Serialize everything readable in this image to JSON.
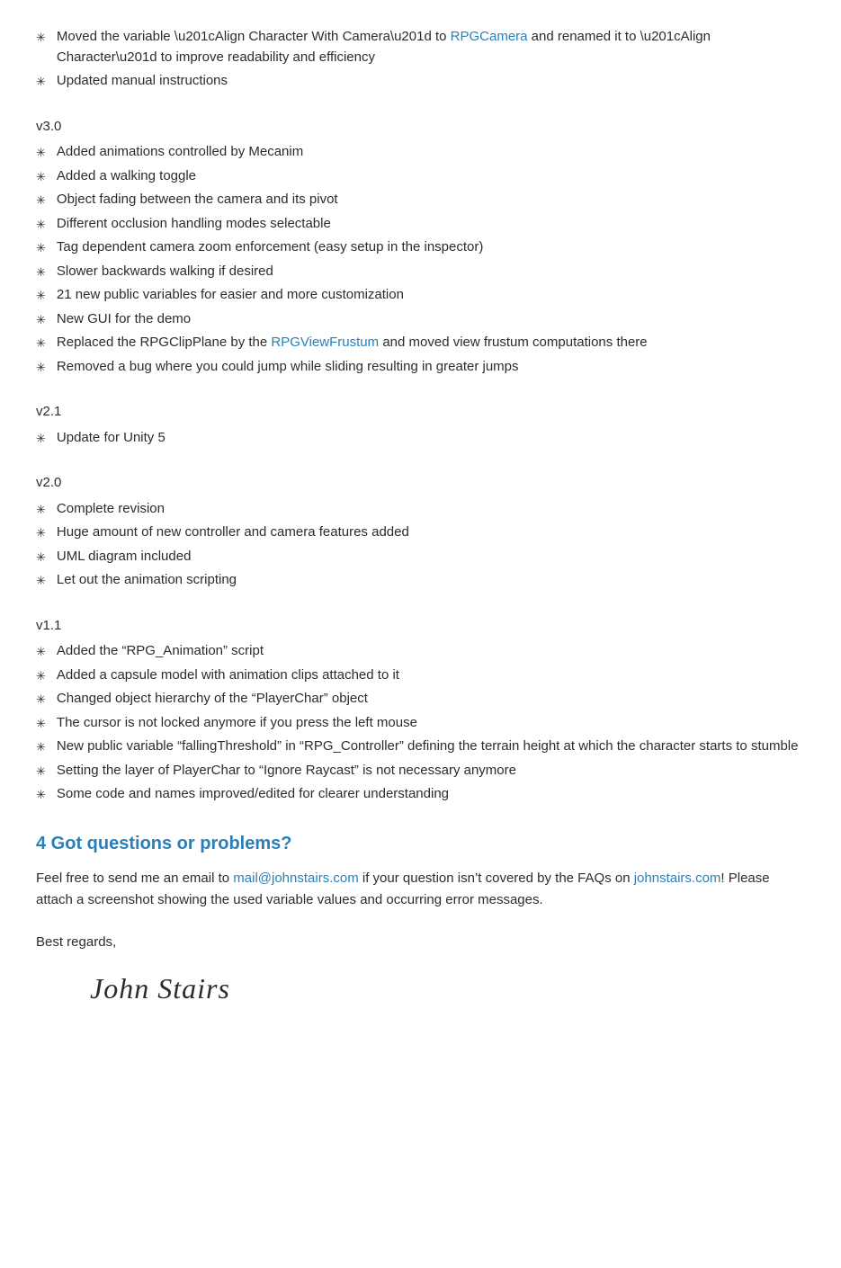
{
  "versions": [
    {
      "id": "v3_extra",
      "label": null,
      "bullets": [
        {
          "text_before": "Moved the variable “Align Character With Camera” to ",
          "link_text": "RPGCamera",
          "link_href": "#RPGCamera",
          "text_after": " and renamed it to “Align Character” to improve readability and efficiency"
        },
        {
          "text_only": "Updated manual instructions"
        }
      ]
    },
    {
      "id": "v3_0",
      "label": "v3.0",
      "bullets": [
        {
          "text_only": "Added animations controlled by Mecanim"
        },
        {
          "text_only": "Added a walking toggle"
        },
        {
          "text_only": "Object fading between the camera and its pivot"
        },
        {
          "text_only": "Different occlusion handling modes selectable"
        },
        {
          "text_only": "Tag dependent camera zoom enforcement (easy setup in the inspector)"
        },
        {
          "text_only": "Slower backwards walking if desired"
        },
        {
          "text_only": "21 new public variables for easier and more customization"
        },
        {
          "text_only": "New GUI for the demo"
        },
        {
          "text_before": "Replaced the RPGClipPlane by the ",
          "link_text": "RPGViewFrustum",
          "link_href": "#RPGViewFrustum",
          "text_after": " and moved view frustum computations there"
        },
        {
          "text_only": "Removed a bug where you could jump while sliding resulting in greater jumps"
        }
      ]
    },
    {
      "id": "v2_1",
      "label": "v2.1",
      "bullets": [
        {
          "text_only": "Update for Unity 5"
        }
      ]
    },
    {
      "id": "v2_0",
      "label": "v2.0",
      "bullets": [
        {
          "text_only": "Complete revision"
        },
        {
          "text_only": "Huge amount of new controller and camera features added"
        },
        {
          "text_only": "UML diagram included"
        },
        {
          "text_only": "Let out the animation scripting"
        }
      ]
    },
    {
      "id": "v1_1",
      "label": "v1.1",
      "bullets": [
        {
          "text_only": "Added the “RPG_Animation” script"
        },
        {
          "text_only": "Added a capsule model with animation clips attached to it"
        },
        {
          "text_only": "Changed object hierarchy of the “PlayerChar” object"
        },
        {
          "text_only": "The cursor is not locked anymore if you press the left mouse"
        },
        {
          "text_only": "New public variable “fallingThreshold” in “RPG_Controller” defining the terrain height at which the character starts to stumble"
        },
        {
          "text_only": "Setting the layer of PlayerChar to “Ignore Raycast” is not necessary anymore"
        },
        {
          "text_only": "Some code and names improved/edited for clearer understanding"
        }
      ]
    }
  ],
  "section4": {
    "heading": "4 Got questions or problems?",
    "paragraph": {
      "text_before": "Feel free to send me an email to ",
      "email_link_text": "mail@johnstairs.com",
      "email_link_href": "mailto:mail@johnstairs.com",
      "text_middle": " if your question isn’t covered by the FAQs on ",
      "website_link_text": "johnstairs.com",
      "website_link_href": "http://johnstairs.com",
      "text_after": "! Please attach a screenshot showing the used variable values and occurring error messages."
    }
  },
  "signature": {
    "best_regards": "Best regards,",
    "name": "John Stairs"
  }
}
